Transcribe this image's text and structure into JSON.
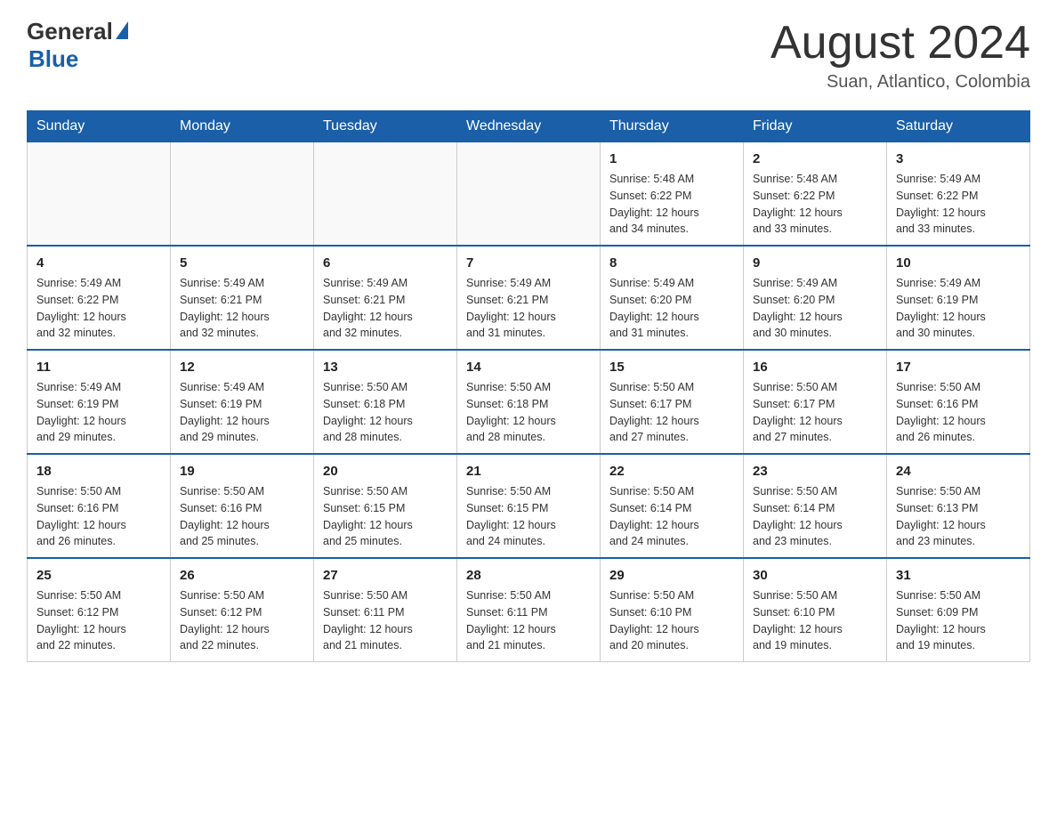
{
  "header": {
    "logo_general": "General",
    "logo_blue": "Blue",
    "month_title": "August 2024",
    "location": "Suan, Atlantico, Colombia"
  },
  "calendar": {
    "days_of_week": [
      "Sunday",
      "Monday",
      "Tuesday",
      "Wednesday",
      "Thursday",
      "Friday",
      "Saturday"
    ],
    "weeks": [
      [
        {
          "day": "",
          "info": ""
        },
        {
          "day": "",
          "info": ""
        },
        {
          "day": "",
          "info": ""
        },
        {
          "day": "",
          "info": ""
        },
        {
          "day": "1",
          "info": "Sunrise: 5:48 AM\nSunset: 6:22 PM\nDaylight: 12 hours\nand 34 minutes."
        },
        {
          "day": "2",
          "info": "Sunrise: 5:48 AM\nSunset: 6:22 PM\nDaylight: 12 hours\nand 33 minutes."
        },
        {
          "day": "3",
          "info": "Sunrise: 5:49 AM\nSunset: 6:22 PM\nDaylight: 12 hours\nand 33 minutes."
        }
      ],
      [
        {
          "day": "4",
          "info": "Sunrise: 5:49 AM\nSunset: 6:22 PM\nDaylight: 12 hours\nand 32 minutes."
        },
        {
          "day": "5",
          "info": "Sunrise: 5:49 AM\nSunset: 6:21 PM\nDaylight: 12 hours\nand 32 minutes."
        },
        {
          "day": "6",
          "info": "Sunrise: 5:49 AM\nSunset: 6:21 PM\nDaylight: 12 hours\nand 32 minutes."
        },
        {
          "day": "7",
          "info": "Sunrise: 5:49 AM\nSunset: 6:21 PM\nDaylight: 12 hours\nand 31 minutes."
        },
        {
          "day": "8",
          "info": "Sunrise: 5:49 AM\nSunset: 6:20 PM\nDaylight: 12 hours\nand 31 minutes."
        },
        {
          "day": "9",
          "info": "Sunrise: 5:49 AM\nSunset: 6:20 PM\nDaylight: 12 hours\nand 30 minutes."
        },
        {
          "day": "10",
          "info": "Sunrise: 5:49 AM\nSunset: 6:19 PM\nDaylight: 12 hours\nand 30 minutes."
        }
      ],
      [
        {
          "day": "11",
          "info": "Sunrise: 5:49 AM\nSunset: 6:19 PM\nDaylight: 12 hours\nand 29 minutes."
        },
        {
          "day": "12",
          "info": "Sunrise: 5:49 AM\nSunset: 6:19 PM\nDaylight: 12 hours\nand 29 minutes."
        },
        {
          "day": "13",
          "info": "Sunrise: 5:50 AM\nSunset: 6:18 PM\nDaylight: 12 hours\nand 28 minutes."
        },
        {
          "day": "14",
          "info": "Sunrise: 5:50 AM\nSunset: 6:18 PM\nDaylight: 12 hours\nand 28 minutes."
        },
        {
          "day": "15",
          "info": "Sunrise: 5:50 AM\nSunset: 6:17 PM\nDaylight: 12 hours\nand 27 minutes."
        },
        {
          "day": "16",
          "info": "Sunrise: 5:50 AM\nSunset: 6:17 PM\nDaylight: 12 hours\nand 27 minutes."
        },
        {
          "day": "17",
          "info": "Sunrise: 5:50 AM\nSunset: 6:16 PM\nDaylight: 12 hours\nand 26 minutes."
        }
      ],
      [
        {
          "day": "18",
          "info": "Sunrise: 5:50 AM\nSunset: 6:16 PM\nDaylight: 12 hours\nand 26 minutes."
        },
        {
          "day": "19",
          "info": "Sunrise: 5:50 AM\nSunset: 6:16 PM\nDaylight: 12 hours\nand 25 minutes."
        },
        {
          "day": "20",
          "info": "Sunrise: 5:50 AM\nSunset: 6:15 PM\nDaylight: 12 hours\nand 25 minutes."
        },
        {
          "day": "21",
          "info": "Sunrise: 5:50 AM\nSunset: 6:15 PM\nDaylight: 12 hours\nand 24 minutes."
        },
        {
          "day": "22",
          "info": "Sunrise: 5:50 AM\nSunset: 6:14 PM\nDaylight: 12 hours\nand 24 minutes."
        },
        {
          "day": "23",
          "info": "Sunrise: 5:50 AM\nSunset: 6:14 PM\nDaylight: 12 hours\nand 23 minutes."
        },
        {
          "day": "24",
          "info": "Sunrise: 5:50 AM\nSunset: 6:13 PM\nDaylight: 12 hours\nand 23 minutes."
        }
      ],
      [
        {
          "day": "25",
          "info": "Sunrise: 5:50 AM\nSunset: 6:12 PM\nDaylight: 12 hours\nand 22 minutes."
        },
        {
          "day": "26",
          "info": "Sunrise: 5:50 AM\nSunset: 6:12 PM\nDaylight: 12 hours\nand 22 minutes."
        },
        {
          "day": "27",
          "info": "Sunrise: 5:50 AM\nSunset: 6:11 PM\nDaylight: 12 hours\nand 21 minutes."
        },
        {
          "day": "28",
          "info": "Sunrise: 5:50 AM\nSunset: 6:11 PM\nDaylight: 12 hours\nand 21 minutes."
        },
        {
          "day": "29",
          "info": "Sunrise: 5:50 AM\nSunset: 6:10 PM\nDaylight: 12 hours\nand 20 minutes."
        },
        {
          "day": "30",
          "info": "Sunrise: 5:50 AM\nSunset: 6:10 PM\nDaylight: 12 hours\nand 19 minutes."
        },
        {
          "day": "31",
          "info": "Sunrise: 5:50 AM\nSunset: 6:09 PM\nDaylight: 12 hours\nand 19 minutes."
        }
      ]
    ]
  }
}
